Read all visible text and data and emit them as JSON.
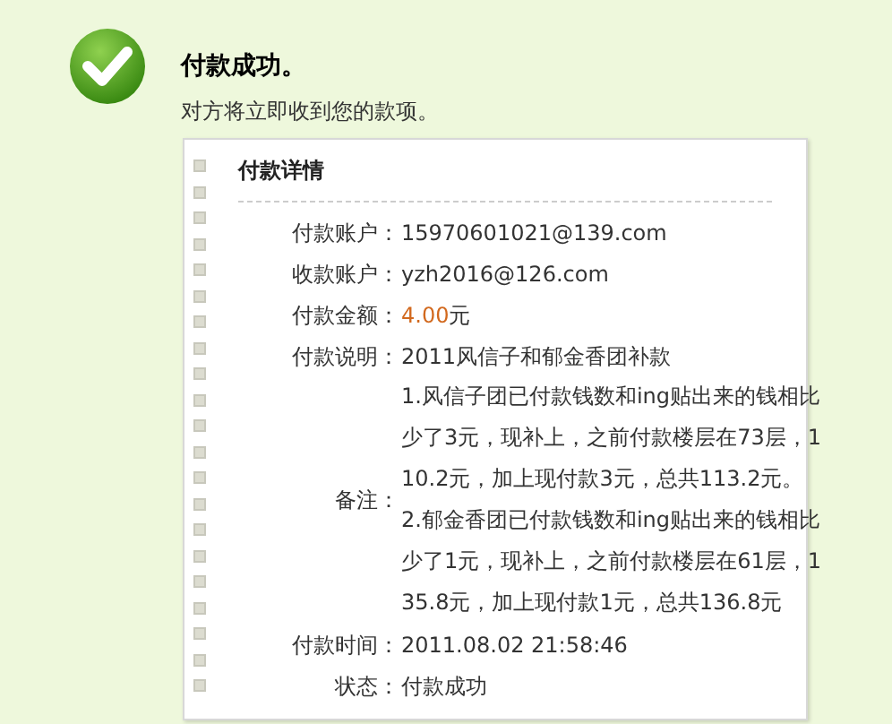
{
  "header": {
    "title": "付款成功。",
    "subtitle": "对方将立即收到您的款项。"
  },
  "details": {
    "heading": "付款详情",
    "rows": [
      {
        "kind": "text",
        "label": "付款账户：",
        "value": "15970601021@139.com"
      },
      {
        "kind": "text",
        "label": "收款账户：",
        "value": "yzh2016@126.com"
      },
      {
        "kind": "amount",
        "label": "付款金额：",
        "value": "4.00",
        "unit": "元"
      },
      {
        "kind": "text",
        "label": "付款说明：",
        "value": "2011风信子和郁金香团补款"
      },
      {
        "kind": "note",
        "label": "备注：",
        "value": "1.风信子团已付款钱数和ing贴出来的钱相比少了3元，现补上，之前付款楼层在73层，110.2元，加上现付款3元，总共113.2元。 2.郁金香团已付款钱数和ing贴出来的钱相比少了1元，现补上，之前付款楼层在61层，135.8元，加上现付款1元，总共136.8元"
      },
      {
        "kind": "text",
        "label": "付款时间：",
        "value": "2011.08.02 21:58:46"
      },
      {
        "kind": "text",
        "label": "状态：",
        "value": "付款成功"
      }
    ]
  }
}
